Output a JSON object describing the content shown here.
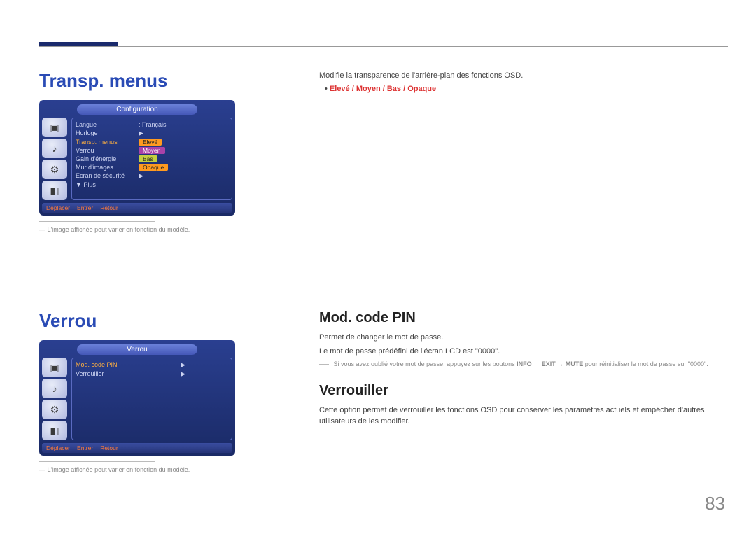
{
  "page_number": "83",
  "section1": {
    "title": "Transp. menus",
    "desc": "Modifie la transparence de l'arrière-plan des fonctions OSD.",
    "options": "Elevé / Moyen / Bas / Opaque",
    "footnote": "L'image affichée peut varier en fonction du modèle.",
    "osd": {
      "title": "Configuration",
      "rows": {
        "langue_l": "Langue",
        "langue_r": ": Français",
        "horloge_l": "Horloge",
        "transp_l": "Transp. menus",
        "transp_r": "Elevé",
        "verrou_l": "Verrou",
        "verrou_r": "Moyen",
        "gain_l": "Gain d'énergie",
        "gain_r": "Bas",
        "mur_l": "Mur d'images",
        "mur_r": "Opaque",
        "ecran_l": "Ecran de sécurité",
        "plus_l": "▼ Plus"
      },
      "foot1": "Déplacer",
      "foot2": "Entrer",
      "foot3": "Retour"
    }
  },
  "section2": {
    "title": "Verrou",
    "footnote": "L'image affichée peut varier en fonction du modèle.",
    "osd": {
      "title": "Verrou",
      "row1_l": "Mod. code PIN",
      "row2_l": "Verrouiller",
      "foot1": "Déplacer",
      "foot2": "Entrer",
      "foot3": "Retour"
    },
    "sub1": {
      "title": "Mod. code PIN",
      "p1": "Permet de changer le mot de passe.",
      "p2": "Le mot de passe prédéfini de l'écran LCD est \"0000\".",
      "note_pre": "Si vous avez oublié votre mot de passe, appuyez sur les boutons ",
      "info": "INFO",
      "arrow": "→",
      "exit": "EXIT",
      "mute": "MUTE",
      "note_post": " pour réinitialiser le mot de passe sur \"0000\"."
    },
    "sub2": {
      "title": "Verrouiller",
      "p1": "Cette option permet de verrouiller les fonctions OSD pour conserver les paramètres actuels et empêcher d'autres utilisateurs de les modifier."
    }
  }
}
